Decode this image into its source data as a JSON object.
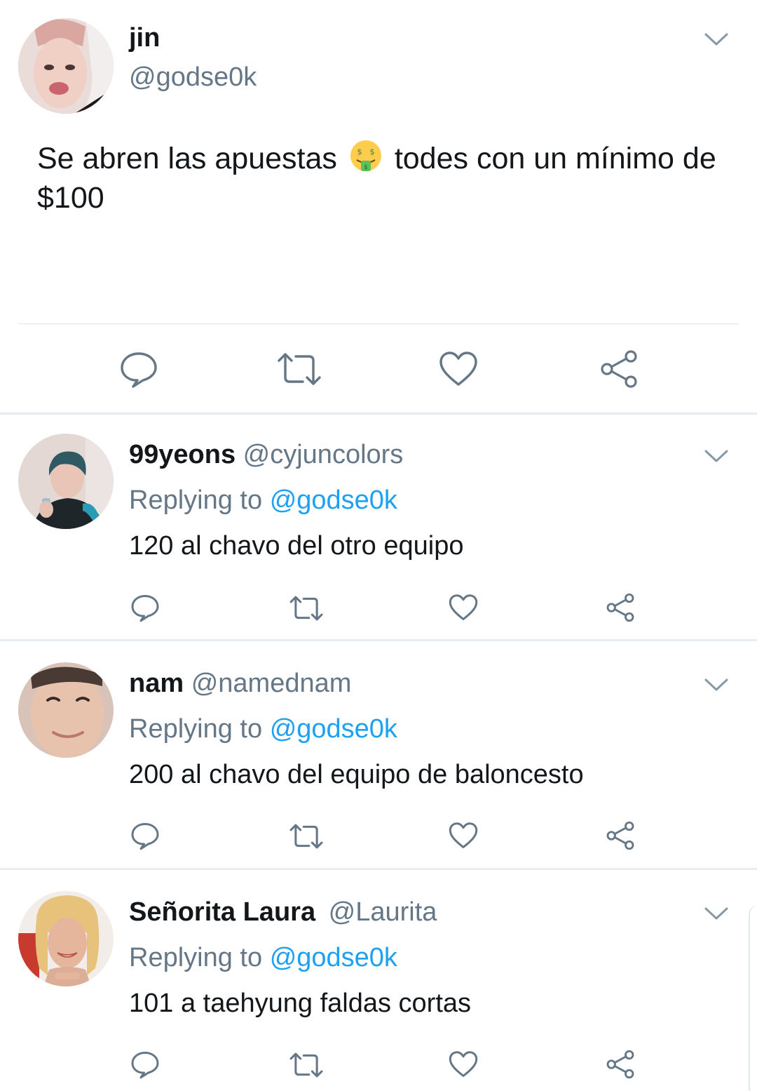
{
  "main_tweet": {
    "display_name": "jin",
    "handle": "@godse0k",
    "text_before_emoji": "Se abren las apuestas",
    "emoji": "money-mouth-face",
    "text_after_emoji": "todes con un mínimo de $100"
  },
  "replies": [
    {
      "display_name": "99yeons",
      "handle": "@cyjuncolors",
      "replying_label": "Replying to",
      "replying_to": "@godse0k",
      "text": "120 al chavo del otro equipo"
    },
    {
      "display_name": "nam",
      "handle": "@namednam",
      "replying_label": "Replying to",
      "replying_to": "@godse0k",
      "text": "200 al chavo del equipo de baloncesto"
    },
    {
      "display_name": "Señorita Laura",
      "handle": "@Laurita",
      "replying_label": "Replying to",
      "replying_to": "@godse0k",
      "text": "101 a taehyung faldas cortas"
    }
  ],
  "icons": {
    "reply": "reply-icon",
    "retweet": "retweet-icon",
    "like": "heart-icon",
    "share": "share-icon",
    "menu": "chevron-down-icon"
  },
  "colors": {
    "primary_text": "#14171a",
    "secondary_text": "#657786",
    "link": "#1da1f2",
    "divider": "#e6ecf0"
  }
}
